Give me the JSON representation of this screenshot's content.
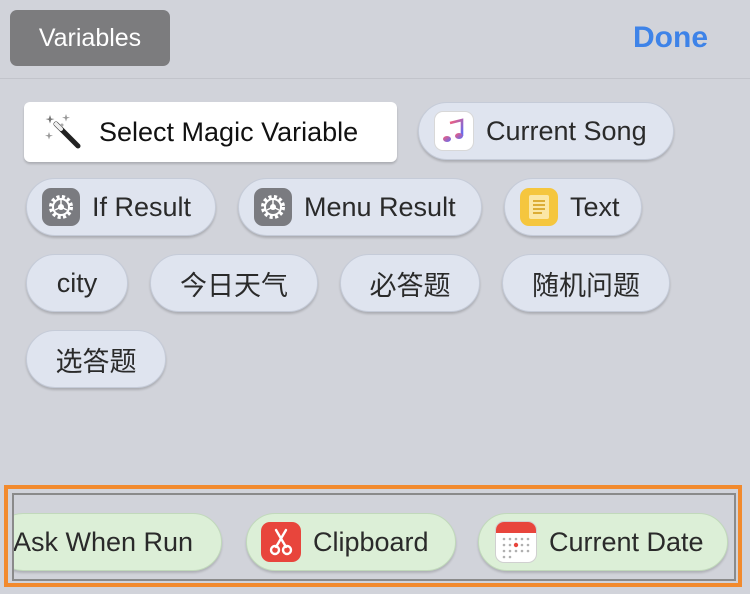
{
  "topbar": {
    "variables_label": "Variables",
    "done_label": "Done"
  },
  "magic_variable": {
    "label": "Select Magic Variable",
    "icon": "magic-wand-icon"
  },
  "chips": [
    {
      "label": "Current Song",
      "icon": "music-note-icon"
    },
    {
      "label": "If Result",
      "icon": "gear-icon"
    },
    {
      "label": "Menu Result",
      "icon": "gear-icon"
    },
    {
      "label": "Text",
      "icon": "notes-icon"
    },
    {
      "label": "city"
    },
    {
      "label": "今日天气"
    },
    {
      "label": "必答题"
    },
    {
      "label": "随机问题"
    },
    {
      "label": "选答题"
    }
  ],
  "special_variables": [
    {
      "label": "Ask When Run"
    },
    {
      "label": "Clipboard",
      "icon": "scissors-icon",
      "icon_color": "#e8453c"
    },
    {
      "label": "Current Date",
      "icon": "calendar-icon",
      "icon_color": "#e8453c"
    }
  ],
  "colors": {
    "accent_blue": "#3e83e8",
    "highlight_orange": "#f28a2d",
    "variable_chip": "#dfe4ef",
    "special_chip": "#dcefd7"
  }
}
